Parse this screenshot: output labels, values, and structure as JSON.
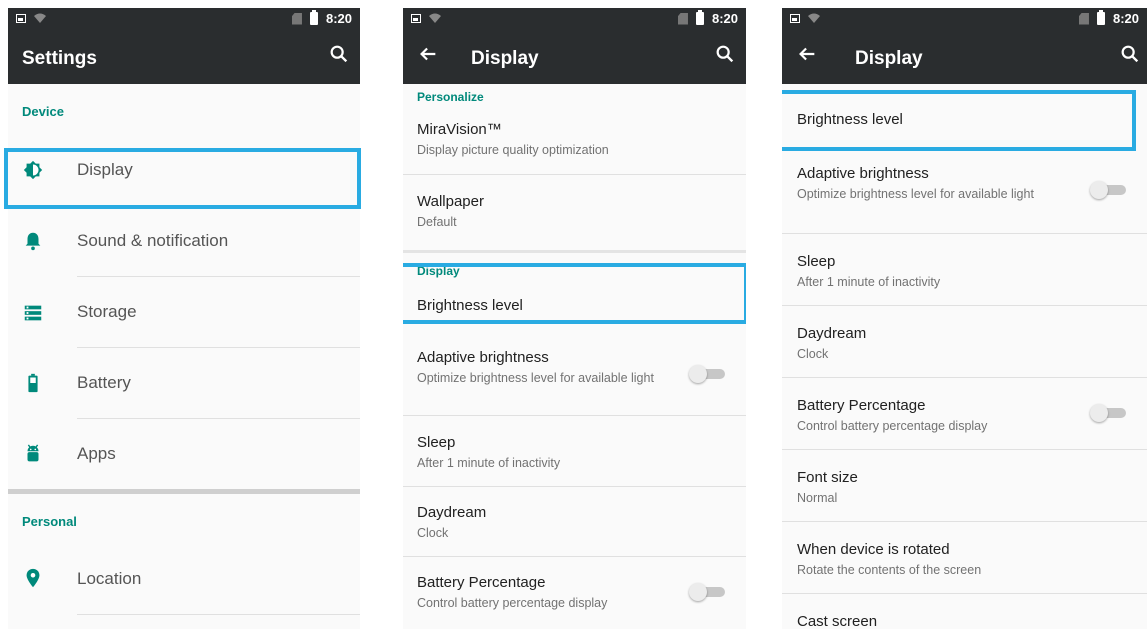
{
  "status_bar": {
    "time": "8:20"
  },
  "panel1": {
    "title": "Settings",
    "section_device": "Device",
    "items": [
      "Display",
      "Sound & notification",
      "Storage",
      "Battery",
      "Apps"
    ],
    "section_personal": "Personal",
    "personal_items": [
      "Location"
    ]
  },
  "panel2": {
    "title": "Display",
    "section_personalize": "Personalize",
    "miravision": {
      "title": "MiraVision™",
      "sub": "Display picture quality optimization"
    },
    "wallpaper": {
      "title": "Wallpaper",
      "sub": "Default"
    },
    "section_display": "Display",
    "brightness": {
      "title": "Brightness level"
    },
    "adaptive": {
      "title": "Adaptive brightness",
      "sub": "Optimize brightness level for available light"
    },
    "sleep": {
      "title": "Sleep",
      "sub": "After 1 minute of inactivity"
    },
    "daydream": {
      "title": "Daydream",
      "sub": "Clock"
    },
    "battery_pct": {
      "title": "Battery Percentage",
      "sub": "Control battery percentage display"
    }
  },
  "panel3": {
    "title": "Display",
    "brightness": {
      "title": "Brightness level"
    },
    "adaptive": {
      "title": "Adaptive brightness",
      "sub": "Optimize brightness level for available light"
    },
    "sleep": {
      "title": "Sleep",
      "sub": "After 1 minute of inactivity"
    },
    "daydream": {
      "title": "Daydream",
      "sub": "Clock"
    },
    "battery_pct": {
      "title": "Battery Percentage",
      "sub": "Control battery percentage display"
    },
    "font_size": {
      "title": "Font size",
      "sub": "Normal"
    },
    "rotated": {
      "title": "When device is rotated",
      "sub": "Rotate the contents of the screen"
    },
    "cast": {
      "title": "Cast screen"
    }
  },
  "colors": {
    "accent": "#00897b",
    "toolbar": "#2a2d2f",
    "highlight": "#29abe2"
  },
  "toggles": {
    "adaptive_brightness": false,
    "battery_percentage": false
  }
}
